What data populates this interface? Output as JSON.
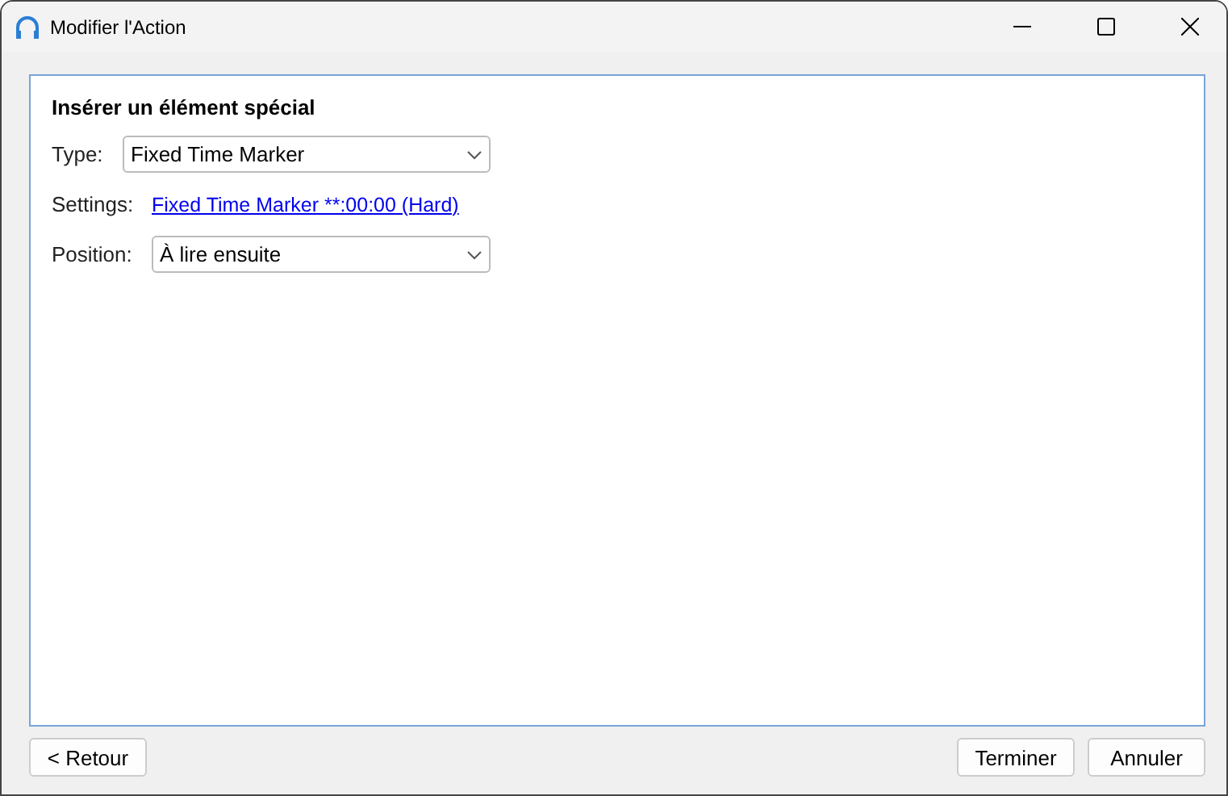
{
  "window": {
    "title": "Modifier l'Action"
  },
  "section": {
    "heading": "Insérer un élément spécial"
  },
  "fields": [
    {
      "kind": "dropdown",
      "label": "Type:",
      "value": "Fixed Time Marker"
    },
    {
      "kind": "link",
      "label": "Settings:",
      "value": "Fixed Time Marker **:00:00 (Hard)"
    },
    {
      "kind": "dropdown",
      "label": "Position:",
      "value": "À lire ensuite"
    }
  ],
  "buttons_left": [
    "< Retour"
  ],
  "buttons_right": [
    "Terminer",
    "Annuler"
  ]
}
